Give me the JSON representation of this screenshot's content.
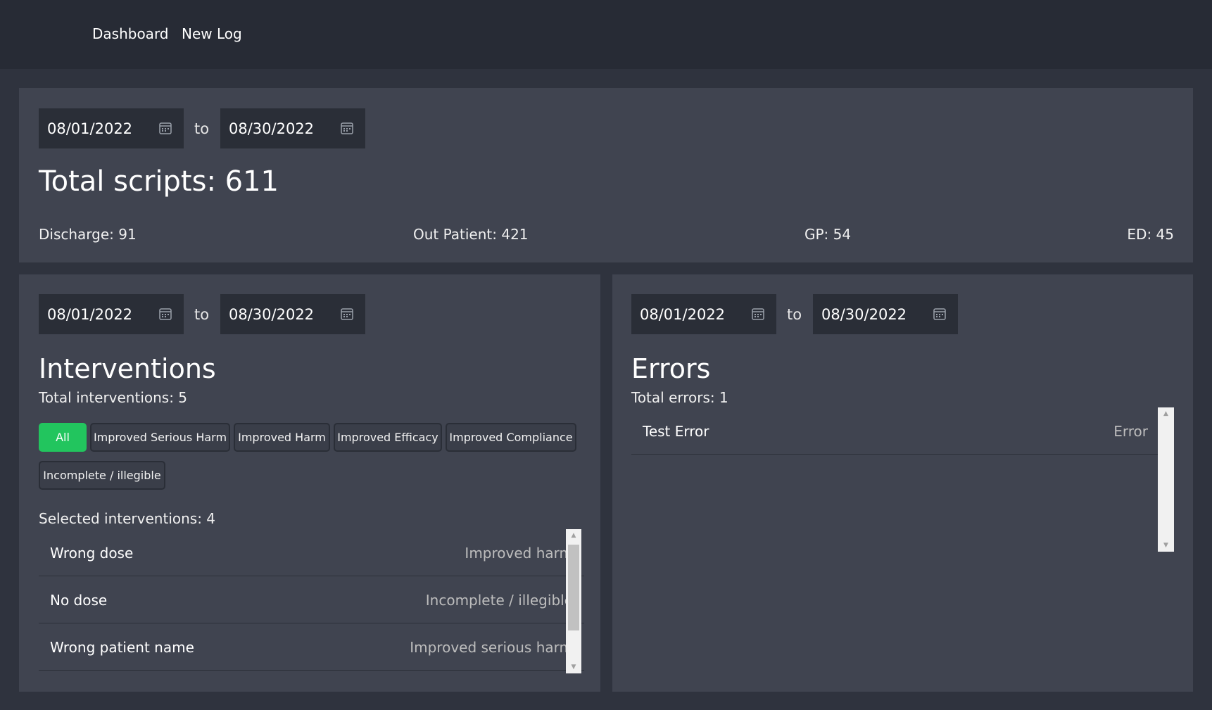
{
  "nav": {
    "dashboard_label": "Dashboard",
    "new_log_label": "New Log"
  },
  "summary": {
    "date_from": "08/01/2022",
    "date_to": "08/30/2022",
    "to_label": "to",
    "total_label": "Total scripts: 611",
    "stats": {
      "discharge": "Discharge: 91",
      "out_patient": "Out Patient: 421",
      "gp": "GP: 54",
      "ed": "ED: 45"
    }
  },
  "interventions": {
    "date_from": "08/01/2022",
    "date_to": "08/30/2022",
    "to_label": "to",
    "title": "Interventions",
    "total_label": "Total interventions: 5",
    "filters": [
      "All",
      "Improved Serious Harm",
      "Improved Harm",
      "Improved Efficacy",
      "Improved Compliance",
      "Incomplete / illegible"
    ],
    "active_filter": "All",
    "selected_label": "Selected interventions: 4",
    "rows": [
      {
        "name": "Wrong dose",
        "type": "Improved harm"
      },
      {
        "name": "No dose",
        "type": "Incomplete / illegible"
      },
      {
        "name": "Wrong patient name",
        "type": "Improved serious harm"
      }
    ]
  },
  "errors": {
    "date_from": "08/01/2022",
    "date_to": "08/30/2022",
    "to_label": "to",
    "title": "Errors",
    "total_label": "Total errors: 1",
    "rows": [
      {
        "name": "Test Error",
        "type": "Error"
      }
    ]
  },
  "colors": {
    "page_bg": "#2f333e",
    "navbar_bg": "#272b35",
    "panel_bg": "#404450",
    "input_bg": "#2a2e37",
    "active_chip": "#22c55e"
  },
  "icons": {
    "date_picker": "calendar-icon",
    "scroll_up": "arrow-up-icon",
    "scroll_down": "arrow-down-icon"
  }
}
